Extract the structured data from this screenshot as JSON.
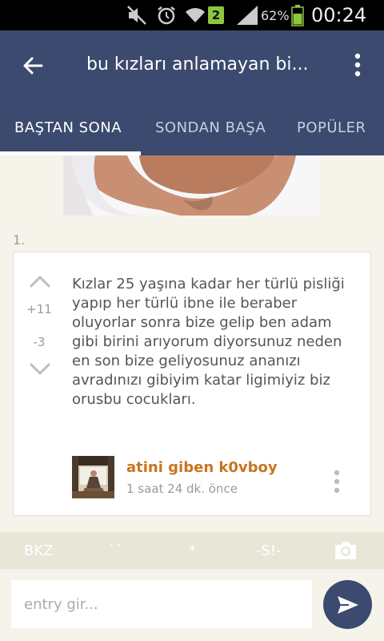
{
  "status_bar": {
    "notification_badge": "2",
    "battery_percent": "62%",
    "time": "00:24",
    "icons": [
      "mute-icon",
      "alarm-icon",
      "wifi-icon",
      "signal-icon",
      "battery-icon"
    ]
  },
  "app_bar": {
    "title": "bu kızları anlamayan bi...",
    "icons": [
      "back-arrow-icon",
      "overflow-menu-icon"
    ]
  },
  "tabs": [
    {
      "label": "BAŞTAN SONA",
      "active": true
    },
    {
      "label": "SONDAN BAŞA",
      "active": false
    },
    {
      "label": "POPÜLER",
      "active": false
    }
  ],
  "entry": {
    "number": "1.",
    "up_votes": "+11",
    "down_votes": "-3",
    "text": "Kızlar 25 yaşına kadar her türlü pisliği yapıp her türlü ibne ile beraber oluyorlar sonra bize gelip ben adam gibi birini arıyorum diyorsunuz neden en son bize geliyosunuz ananızı avradınızı gibiyim katar ligimiyiz biz orusbu cocukları.",
    "author": "atini giben k0vboy",
    "time": "1 saat 24 dk. önce"
  },
  "shortcuts": [
    {
      "label": "BKZ"
    },
    {
      "label": "``"
    },
    {
      "label": "*"
    },
    {
      "label": "-S!-"
    }
  ],
  "shortcut_icons": [
    "camera-icon"
  ],
  "input": {
    "placeholder": "entry gir..."
  },
  "colors": {
    "primary": "#3b4a6e",
    "author": "#c8751f",
    "background": "#f5f3ea",
    "shortcut_bar": "#e8e6d6"
  }
}
